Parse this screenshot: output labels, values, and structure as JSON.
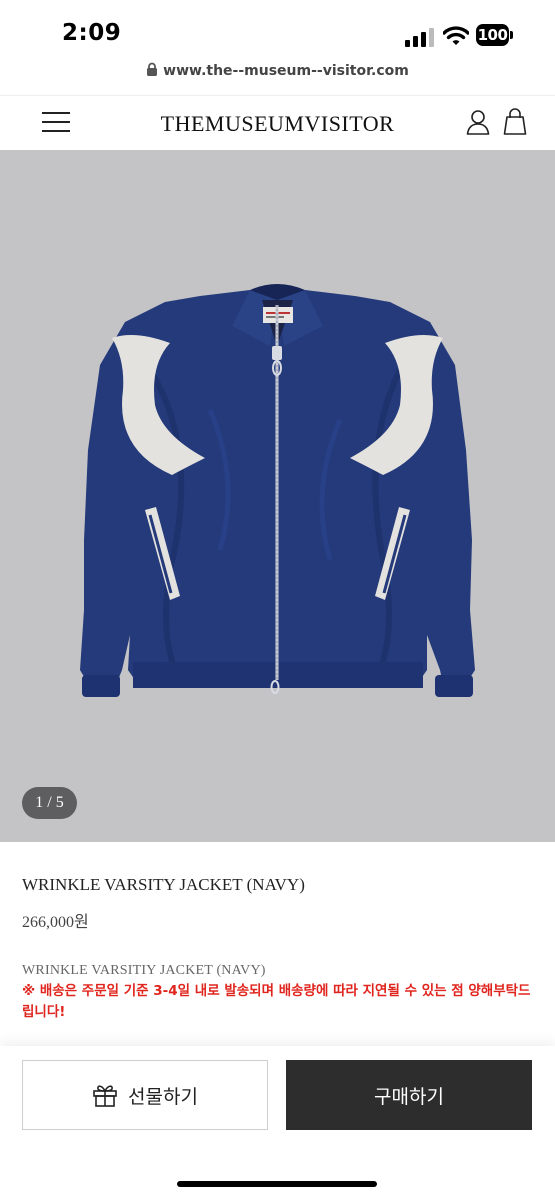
{
  "status": {
    "time": "2:09",
    "battery": "100"
  },
  "browser": {
    "url": "www.the--museum--visitor.com"
  },
  "header": {
    "brand": "THEMUSEUMVISITOR"
  },
  "gallery": {
    "pager": "1 / 5",
    "current": 1,
    "total": 5,
    "background": "#c4c4c6",
    "jacket_color": "#243a7a"
  },
  "product": {
    "name": "WRINKLE VARSITY JACKET (NAVY)",
    "price": "266,000원",
    "description_title": "WRINKLE VARSITIY JACKET (NAVY)",
    "notice": "※ 배송은 주문일 기준 3-4일 내로 발송되며 배송량에 따라 지연될 수 있는 점 양해부탁드립니다!",
    "notice_color": "#e0251e"
  },
  "actions": {
    "gift_label": "선물하기",
    "buy_label": "구매하기",
    "buy_color": "#2d2d2d"
  }
}
